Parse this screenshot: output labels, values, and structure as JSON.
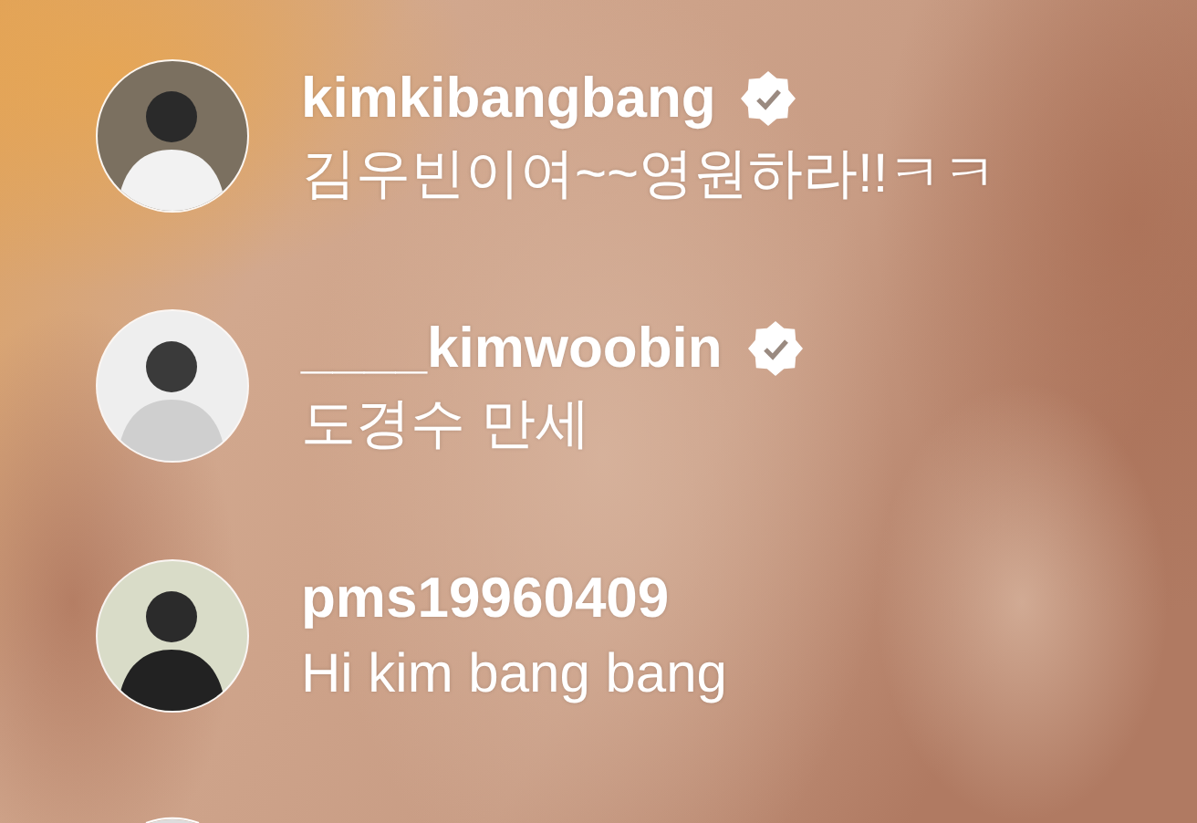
{
  "comments": [
    {
      "kind": "comment",
      "username": "kimkibangbang",
      "verified": true,
      "text": "김우빈이여~~영원하라!!ㅋㅋ"
    },
    {
      "kind": "comment",
      "username": "____kimwoobin",
      "verified": true,
      "text": "도경수 만세"
    },
    {
      "kind": "comment",
      "username": "pms19960409",
      "verified": false,
      "text": "Hi kim bang bang"
    },
    {
      "kind": "partial"
    }
  ]
}
